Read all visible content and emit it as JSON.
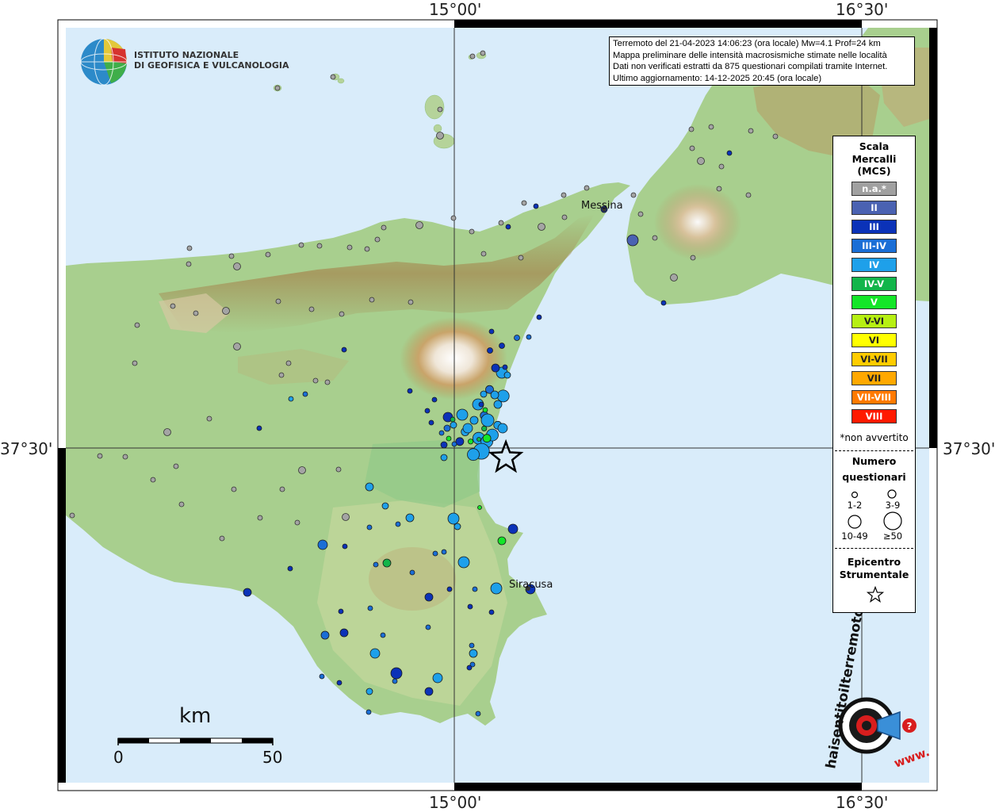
{
  "coords": {
    "top_left": "15°00'",
    "top_right": "16°30'",
    "bottom_left": "15°00'",
    "bottom_right": "16°30'",
    "left_lat": "37°30'",
    "right_lat": "37°30'"
  },
  "logo": {
    "line1": "ISTITUTO NAZIONALE",
    "line2": "DI GEOFISICA E VULCANOLOGIA"
  },
  "info": {
    "line1": "Terremoto del 21-04-2023 14:06:23 (ora locale) Mw=4.1 Prof=24 km",
    "line2": "Mappa preliminare delle intensità macrosismiche stimate nelle località",
    "line3": "Dati non verificati estratti da 875 questionari compilati tramite Internet.",
    "line4": "Ultimo aggiornamento: 14-12-2025 20:45 (ora locale)"
  },
  "cities": {
    "messina": "Messina",
    "siracusa": "Siracusa"
  },
  "legend": {
    "title_lines": [
      "Scala",
      "Mercalli",
      "(MCS)"
    ],
    "classes": [
      {
        "label": "n.a.*",
        "color": "#a0a0a0"
      },
      {
        "label": "II",
        "color": "#4a62b2"
      },
      {
        "label": "III",
        "color": "#0b32b8"
      },
      {
        "label": "III-IV",
        "color": "#1a6ed6"
      },
      {
        "label": "IV",
        "color": "#1ea0ea"
      },
      {
        "label": "IV-V",
        "color": "#12b54a"
      },
      {
        "label": "V",
        "color": "#14e628"
      },
      {
        "label": "V-VI",
        "color": "#b6f012"
      },
      {
        "label": "VI",
        "color": "#ffff00"
      },
      {
        "label": "VI-VII",
        "color": "#ffcc00"
      },
      {
        "label": "VII",
        "color": "#ffa800"
      },
      {
        "label": "VII-VIII",
        "color": "#ff7a00"
      },
      {
        "label": "VIII",
        "color": "#ff1a00"
      }
    ],
    "not_felt": "*non avvertito",
    "questionnaires_title_1": "Numero",
    "questionnaires_title_2": "questionari",
    "sizes": [
      "1-2",
      "3-9",
      "10-49",
      "≥50"
    ],
    "epicenter_title_1": "Epicentro",
    "epicenter_title_2": "Strumentale"
  },
  "scale": {
    "unit": "km",
    "min": "0",
    "max": "50"
  },
  "hsit": {
    "text1": "haisentitoilterremoto.it",
    "text2": "www."
  },
  "epicenter": {
    "lon": 15.19,
    "lat": 37.47
  },
  "points": [
    {
      "lon": 15.04,
      "lat": 37.55,
      "cls": "IV",
      "size": "3-9"
    },
    {
      "lon": 15.09,
      "lat": 37.53,
      "cls": "IV",
      "size": "10-49"
    },
    {
      "lon": 15.12,
      "lat": 37.52,
      "cls": "IV",
      "size": "10-49"
    },
    {
      "lon": 15.1,
      "lat": 37.49,
      "cls": "IV",
      "size": "≥50"
    },
    {
      "lon": 15.07,
      "lat": 37.48,
      "cls": "IV",
      "size": "10-49"
    },
    {
      "lon": 15.14,
      "lat": 37.54,
      "cls": "IV",
      "size": "10-49"
    },
    {
      "lon": 15.16,
      "lat": 37.57,
      "cls": "IV",
      "size": "3-9"
    },
    {
      "lon": 15.18,
      "lat": 37.66,
      "cls": "IV",
      "size": "10-49"
    },
    {
      "lon": 15.11,
      "lat": 37.56,
      "cls": "IV-V",
      "size": "1-2"
    },
    {
      "lon": 15.12,
      "lat": 37.53,
      "cls": "V",
      "size": "3-9"
    },
    {
      "lon": 15.06,
      "lat": 37.52,
      "cls": "V",
      "size": "1-2"
    },
    {
      "lon": 15.02,
      "lat": 37.52,
      "cls": "III",
      "size": "3-9"
    },
    {
      "lon": 15.11,
      "lat": 37.6,
      "cls": "III-IV",
      "size": "3-9"
    },
    {
      "lon": 15.13,
      "lat": 37.68,
      "cls": "III-IV",
      "size": "3-9"
    }
  ]
}
